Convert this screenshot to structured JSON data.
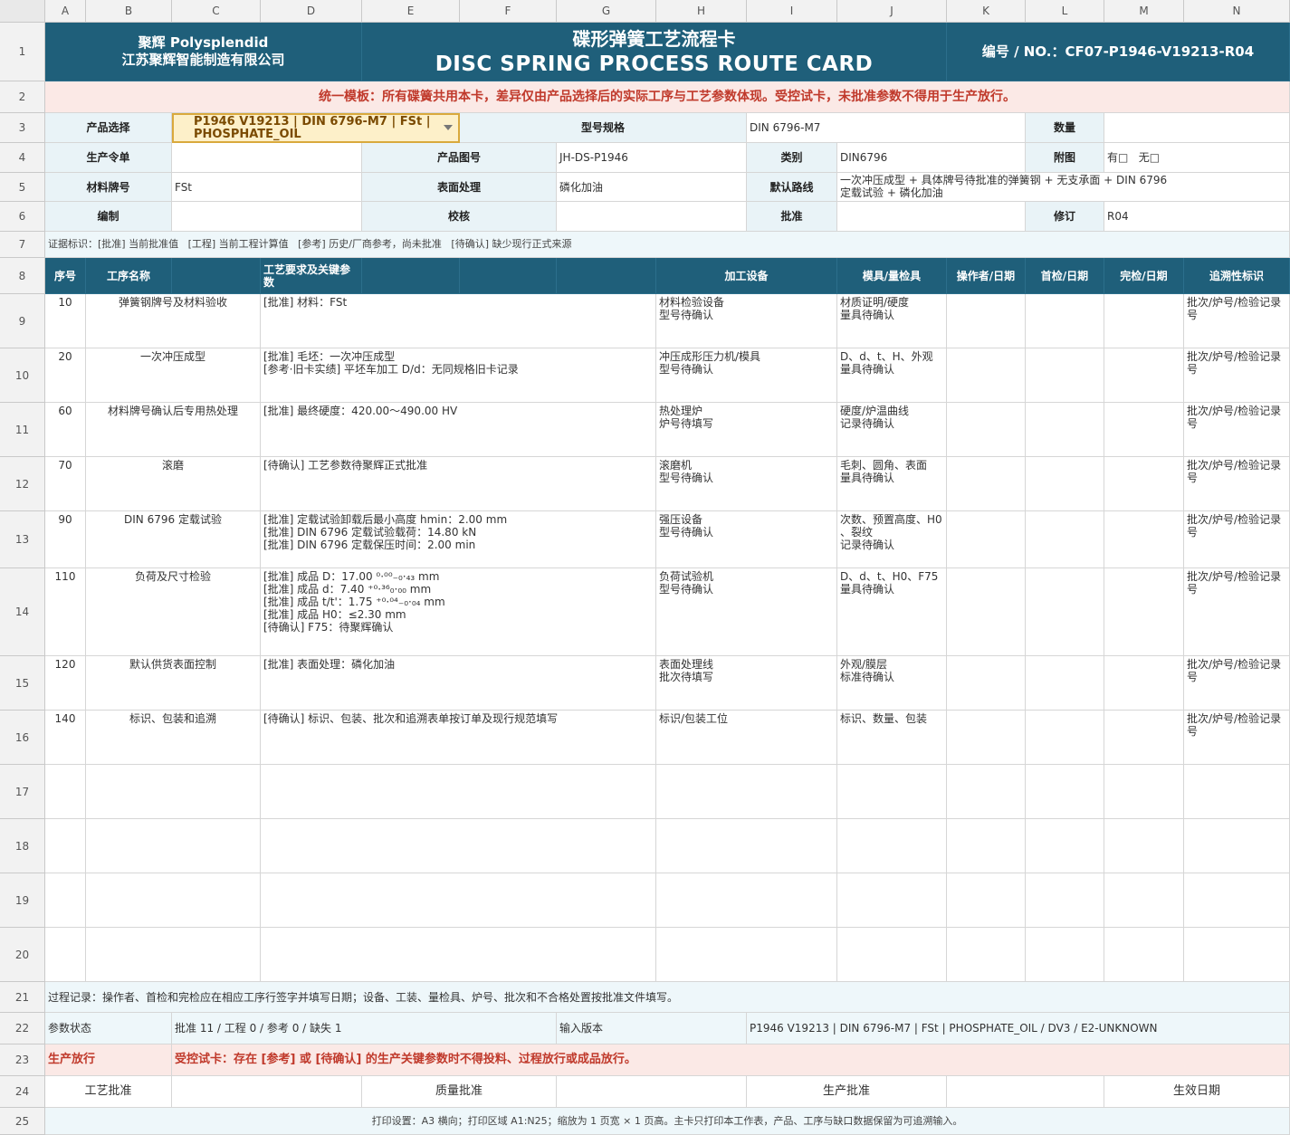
{
  "columns": [
    "A",
    "B",
    "C",
    "D",
    "E",
    "F",
    "G",
    "H",
    "I",
    "J",
    "K",
    "L",
    "M",
    "N"
  ],
  "rows": [
    "1",
    "2",
    "3",
    "4",
    "5",
    "6",
    "7",
    "8",
    "9",
    "10",
    "11",
    "12",
    "13",
    "14",
    "15",
    "16",
    "17",
    "18",
    "19",
    "20",
    "21",
    "22",
    "23",
    "24",
    "25"
  ],
  "header": {
    "company_line1": "聚辉 Polysplendid",
    "company_line2": "江苏聚辉智能制造有限公司",
    "title_cn": "碟形弹簧工艺流程卡",
    "title_en": "DISC SPRING PROCESS ROUTE CARD",
    "doc_no": "编号 / NO.：CF07-P1946-V19213-R04"
  },
  "notice": "统一模板：所有碟簧共用本卡，差异仅由产品选择后的实际工序与工艺参数体现。受控试卡，未批准参数不得用于生产放行。",
  "info": {
    "product_select_label": "产品选择",
    "product_select_value": "P1946 V19213 | DIN 6796-M7 | FSt | PHOSPHATE_OIL",
    "model_label": "型号规格",
    "model_value": "DIN 6796-M7",
    "qty_label": "数量",
    "qty_value": "",
    "order_label": "生产令单",
    "order_value": "",
    "drawing_label": "产品图号",
    "drawing_value": "JH-DS-P1946",
    "category_label": "类别",
    "category_value": "DIN6796",
    "attach_label": "附图",
    "attach_value": "有□   无□",
    "material_label": "材料牌号",
    "material_value": "FSt",
    "surface_label": "表面处理",
    "surface_value": "磷化加油",
    "route_label": "默认路线",
    "route_value": "一次冲压成型 + 具体牌号待批准的弹簧钢 + 无支承面 + DIN 6796\n定载试验 + 磷化加油",
    "prepare_label": "编制",
    "prepare_value": "",
    "check_label": "校核",
    "check_value": "",
    "approve_label": "批准",
    "approve_value": "",
    "revision_label": "修订",
    "revision_value": "R04"
  },
  "legend": "证据标识：[批准] 当前批准值   [工程] 当前工程计算值   [参考] 历史/厂商参考，尚未批准   [待确认] 缺少现行正式来源",
  "table_headers": {
    "seq": "序号",
    "op_name": "工序名称",
    "requirements": "工艺要求及关键参数",
    "equipment": "加工设备",
    "tooling": "模具/量检具",
    "operator": "操作者/日期",
    "first_check": "首检/日期",
    "final_check": "完检/日期",
    "trace": "追溯性标识"
  },
  "operations": [
    {
      "seq": "10",
      "name": "弹簧钢牌号及材料验收",
      "req": "[批准] 材料：FSt",
      "equip": "材料检验设备\n型号待确认",
      "tool": "材质证明/硬度\n量具待确认",
      "trace": "批次/炉号/检验记录号"
    },
    {
      "seq": "20",
      "name": "一次冲压成型",
      "req": "[批准] 毛坯：一次冲压成型\n[参考·旧卡实绩] 平坯车加工 D/d：无同规格旧卡记录",
      "equip": "冲压成形压力机/模具\n型号待确认",
      "tool": "D、d、t、H、外观\n量具待确认",
      "trace": "批次/炉号/检验记录号"
    },
    {
      "seq": "60",
      "name": "材料牌号确认后专用热处理",
      "req": "[批准] 最终硬度：420.00～490.00 HV",
      "equip": "热处理炉\n炉号待填写",
      "tool": "硬度/炉温曲线\n记录待确认",
      "trace": "批次/炉号/检验记录号"
    },
    {
      "seq": "70",
      "name": "滚磨",
      "req": "[待确认] 工艺参数待聚辉正式批准",
      "equip": "滚磨机\n型号待确认",
      "tool": "毛刺、圆角、表面\n量具待确认",
      "trace": "批次/炉号/检验记录号"
    },
    {
      "seq": "90",
      "name": "DIN 6796 定载试验",
      "req": "[批准] 定载试验卸载后最小高度 hmin：2.00 mm\n[批准] DIN 6796 定载试验载荷：14.80 kN\n[批准] DIN 6796 定载保压时间：2.00 min",
      "equip": "强压设备\n型号待确认",
      "tool": "次数、预置高度、H0\n、裂纹\n记录待确认",
      "trace": "批次/炉号/检验记录号"
    },
    {
      "seq": "110",
      "name": "负荷及尺寸检验",
      "req": "[批准] 成品 D：17.00 ⁰·⁰⁰₋₀·₄₃ mm\n[批准] 成品 d：7.40 ⁺⁰·³⁶₀·₀₀ mm\n[批准] 成品 t/t'：1.75 ⁺⁰·⁰⁴₋₀·₀₄ mm\n[批准] 成品 H0：≤2.30 mm\n[待确认] F75：待聚辉确认",
      "equip": "负荷试验机\n型号待确认",
      "tool": "D、d、t、H0、F75\n量具待确认",
      "trace": "批次/炉号/检验记录号"
    },
    {
      "seq": "120",
      "name": "默认供货表面控制",
      "req": "[批准] 表面处理：磷化加油",
      "equip": "表面处理线\n批次待填写",
      "tool": "外观/膜层\n标准待确认",
      "trace": "批次/炉号/检验记录号"
    },
    {
      "seq": "140",
      "name": "标识、包装和追溯",
      "req": "[待确认] 标识、包装、批次和追溯表单按订单及现行规范填写",
      "equip": "标识/包装工位",
      "tool": "标识、数量、包装",
      "trace": "批次/炉号/检验记录号"
    }
  ],
  "footer": {
    "process_record": "过程记录：操作者、首检和完检应在相应工序行签字并填写日期；设备、工装、量检具、炉号、批次和不合格处置按批准文件填写。",
    "param_status_label": "参数状态",
    "param_status_value": "批准 11 / 工程 0 / 参考 0 / 缺失 1",
    "input_version_label": "输入版本",
    "input_version_value": "P1946 V19213 | DIN 6796-M7 | FSt | PHOSPHATE_OIL / DV3 / E2-UNKNOWN",
    "release_label": "生产放行",
    "release_value": "受控试卡：存在 [参考] 或 [待确认] 的生产关键参数时不得投料、过程放行或成品放行。",
    "process_approval": "工艺批准",
    "quality_approval": "质量批准",
    "production_approval": "生产批准",
    "effective_date": "生效日期",
    "print_settings": "打印设置：A3 横向；打印区域 A1:N25；缩放为 1 页宽 × 1 页高。主卡只打印本工作表，产品、工序与缺口数据保留为可追溯输入。"
  },
  "colors": {
    "navy": "#1f5f7a",
    "label_bg": "#e9f3f7",
    "notice_bg": "#fbe9e6",
    "alert_red": "#c0392b",
    "dropdown_bg": "#fdf0c9"
  }
}
